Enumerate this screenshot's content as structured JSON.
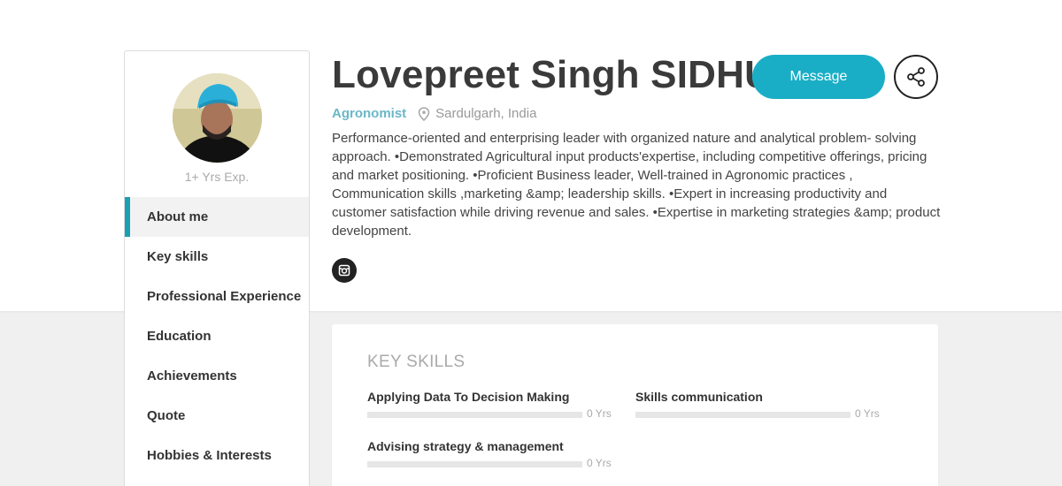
{
  "profile": {
    "name": "Lovepreet Singh SIDHU",
    "role": "Agronomist",
    "location": "Sardulgarh, India",
    "experience": "1+ Yrs Exp.",
    "bio": "Performance-oriented and enterprising leader with organized nature and analytical problem- solving approach. •Demonstrated Agricultural input products'expertise, including competitive offerings, pricing and market positioning. •Proficient Business leader, Well-trained in Agronomic practices , Communication skills ,marketing &amp; leadership skills. •Expert in increasing productivity and customer satisfaction while driving revenue and sales. •Expertise in marketing strategies &amp; product development."
  },
  "actions": {
    "message_label": "Message"
  },
  "nav": {
    "items": [
      {
        "label": "About me"
      },
      {
        "label": "Key skills"
      },
      {
        "label": "Professional Experience"
      },
      {
        "label": "Education"
      },
      {
        "label": "Achievements"
      },
      {
        "label": "Quote"
      },
      {
        "label": "Hobbies & Interests"
      }
    ]
  },
  "skills_card": {
    "title": "KEY SKILLS",
    "skills": [
      {
        "name": "Applying Data To Decision Making",
        "years": "0 Yrs",
        "level": 0
      },
      {
        "name": "Skills communication",
        "years": "0 Yrs",
        "level": 0
      },
      {
        "name": "Advising strategy & management",
        "years": "0 Yrs",
        "level": 0
      }
    ]
  },
  "colors": {
    "accent": "#1aaec6",
    "role": "#6ab7c7",
    "nav_indicator": "#1a9fb3"
  },
  "icons": {
    "share": "share-icon",
    "location": "location-pin-icon",
    "social": "instagram-icon"
  }
}
